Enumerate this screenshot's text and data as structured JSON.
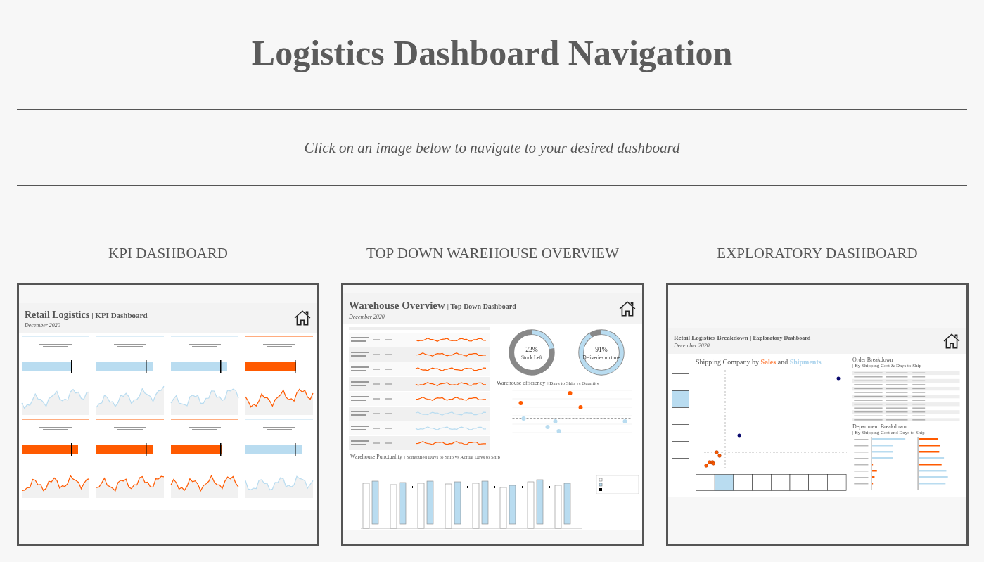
{
  "page": {
    "title": "Logistics Dashboard Navigation",
    "instruction": "Click on an image below to navigate to your desired dashboard"
  },
  "dashboards": [
    {
      "kind": "kpi",
      "heading": "KPI DASHBOARD",
      "title": "Retail Logistics",
      "subtitle": "| KPI Dashboard",
      "date": "December 2020",
      "cards": [
        {
          "color": "#b9dcf0"
        },
        {
          "color": "#b9dcf0"
        },
        {
          "color": "#b9dcf0"
        },
        {
          "color": "#ff5a00"
        },
        {
          "color": "#ff5a00"
        },
        {
          "color": "#ff5a00"
        },
        {
          "color": "#ff5a00"
        },
        {
          "color": "#b9dcf0"
        }
      ]
    },
    {
      "kind": "warehouse",
      "heading": "TOP DOWN WAREHOUSE OVERVIEW",
      "title": "Warehouse Overview",
      "subtitle": "| Top Down Dashboard",
      "date": "December 2020",
      "rows": [
        {
          "color": "#ff5a00"
        },
        {
          "color": "#ff5a00"
        },
        {
          "color": "#ff5a00"
        },
        {
          "color": "#ff5a00"
        },
        {
          "color": "#ff5a00"
        },
        {
          "color": "#b9dcf0"
        },
        {
          "color": "#b9dcf0"
        },
        {
          "color": "#ff5a00"
        }
      ],
      "donuts": [
        {
          "value": "22%",
          "label": "Stock Left",
          "level": 0.22
        },
        {
          "value": "91%",
          "label": "Deliveries on time",
          "level": 0.91
        }
      ],
      "efficiency": {
        "title": "Warehouse efficiency",
        "subtitle": "| Days to Ship vs Quantity"
      },
      "punctuality": {
        "title": "Warehouse Punctuality",
        "subtitle": "| Scheduled Days to Ship vs Actual Days to Ship"
      }
    },
    {
      "kind": "exploratory",
      "heading": "EXPLORATORY DASHBOARD",
      "title": "Retail Logistics Breakdown",
      "subtitle": "| Exploratory Dashboard",
      "date": "December 2020",
      "scatter_title": [
        {
          "text": "Shipping Company by "
        },
        {
          "text": "Sales",
          "color": "#ff7f3f"
        },
        {
          "text": " and "
        },
        {
          "text": "Shipments",
          "color": "#a9d2ec"
        }
      ],
      "order": {
        "title": "Order Breakdown",
        "subtitle": "| By Shipping Cost & Days to Ship"
      },
      "department": {
        "title": "Department Breakdown",
        "subtitle": "| By Shipping Cost and Days to Ship"
      }
    }
  ]
}
